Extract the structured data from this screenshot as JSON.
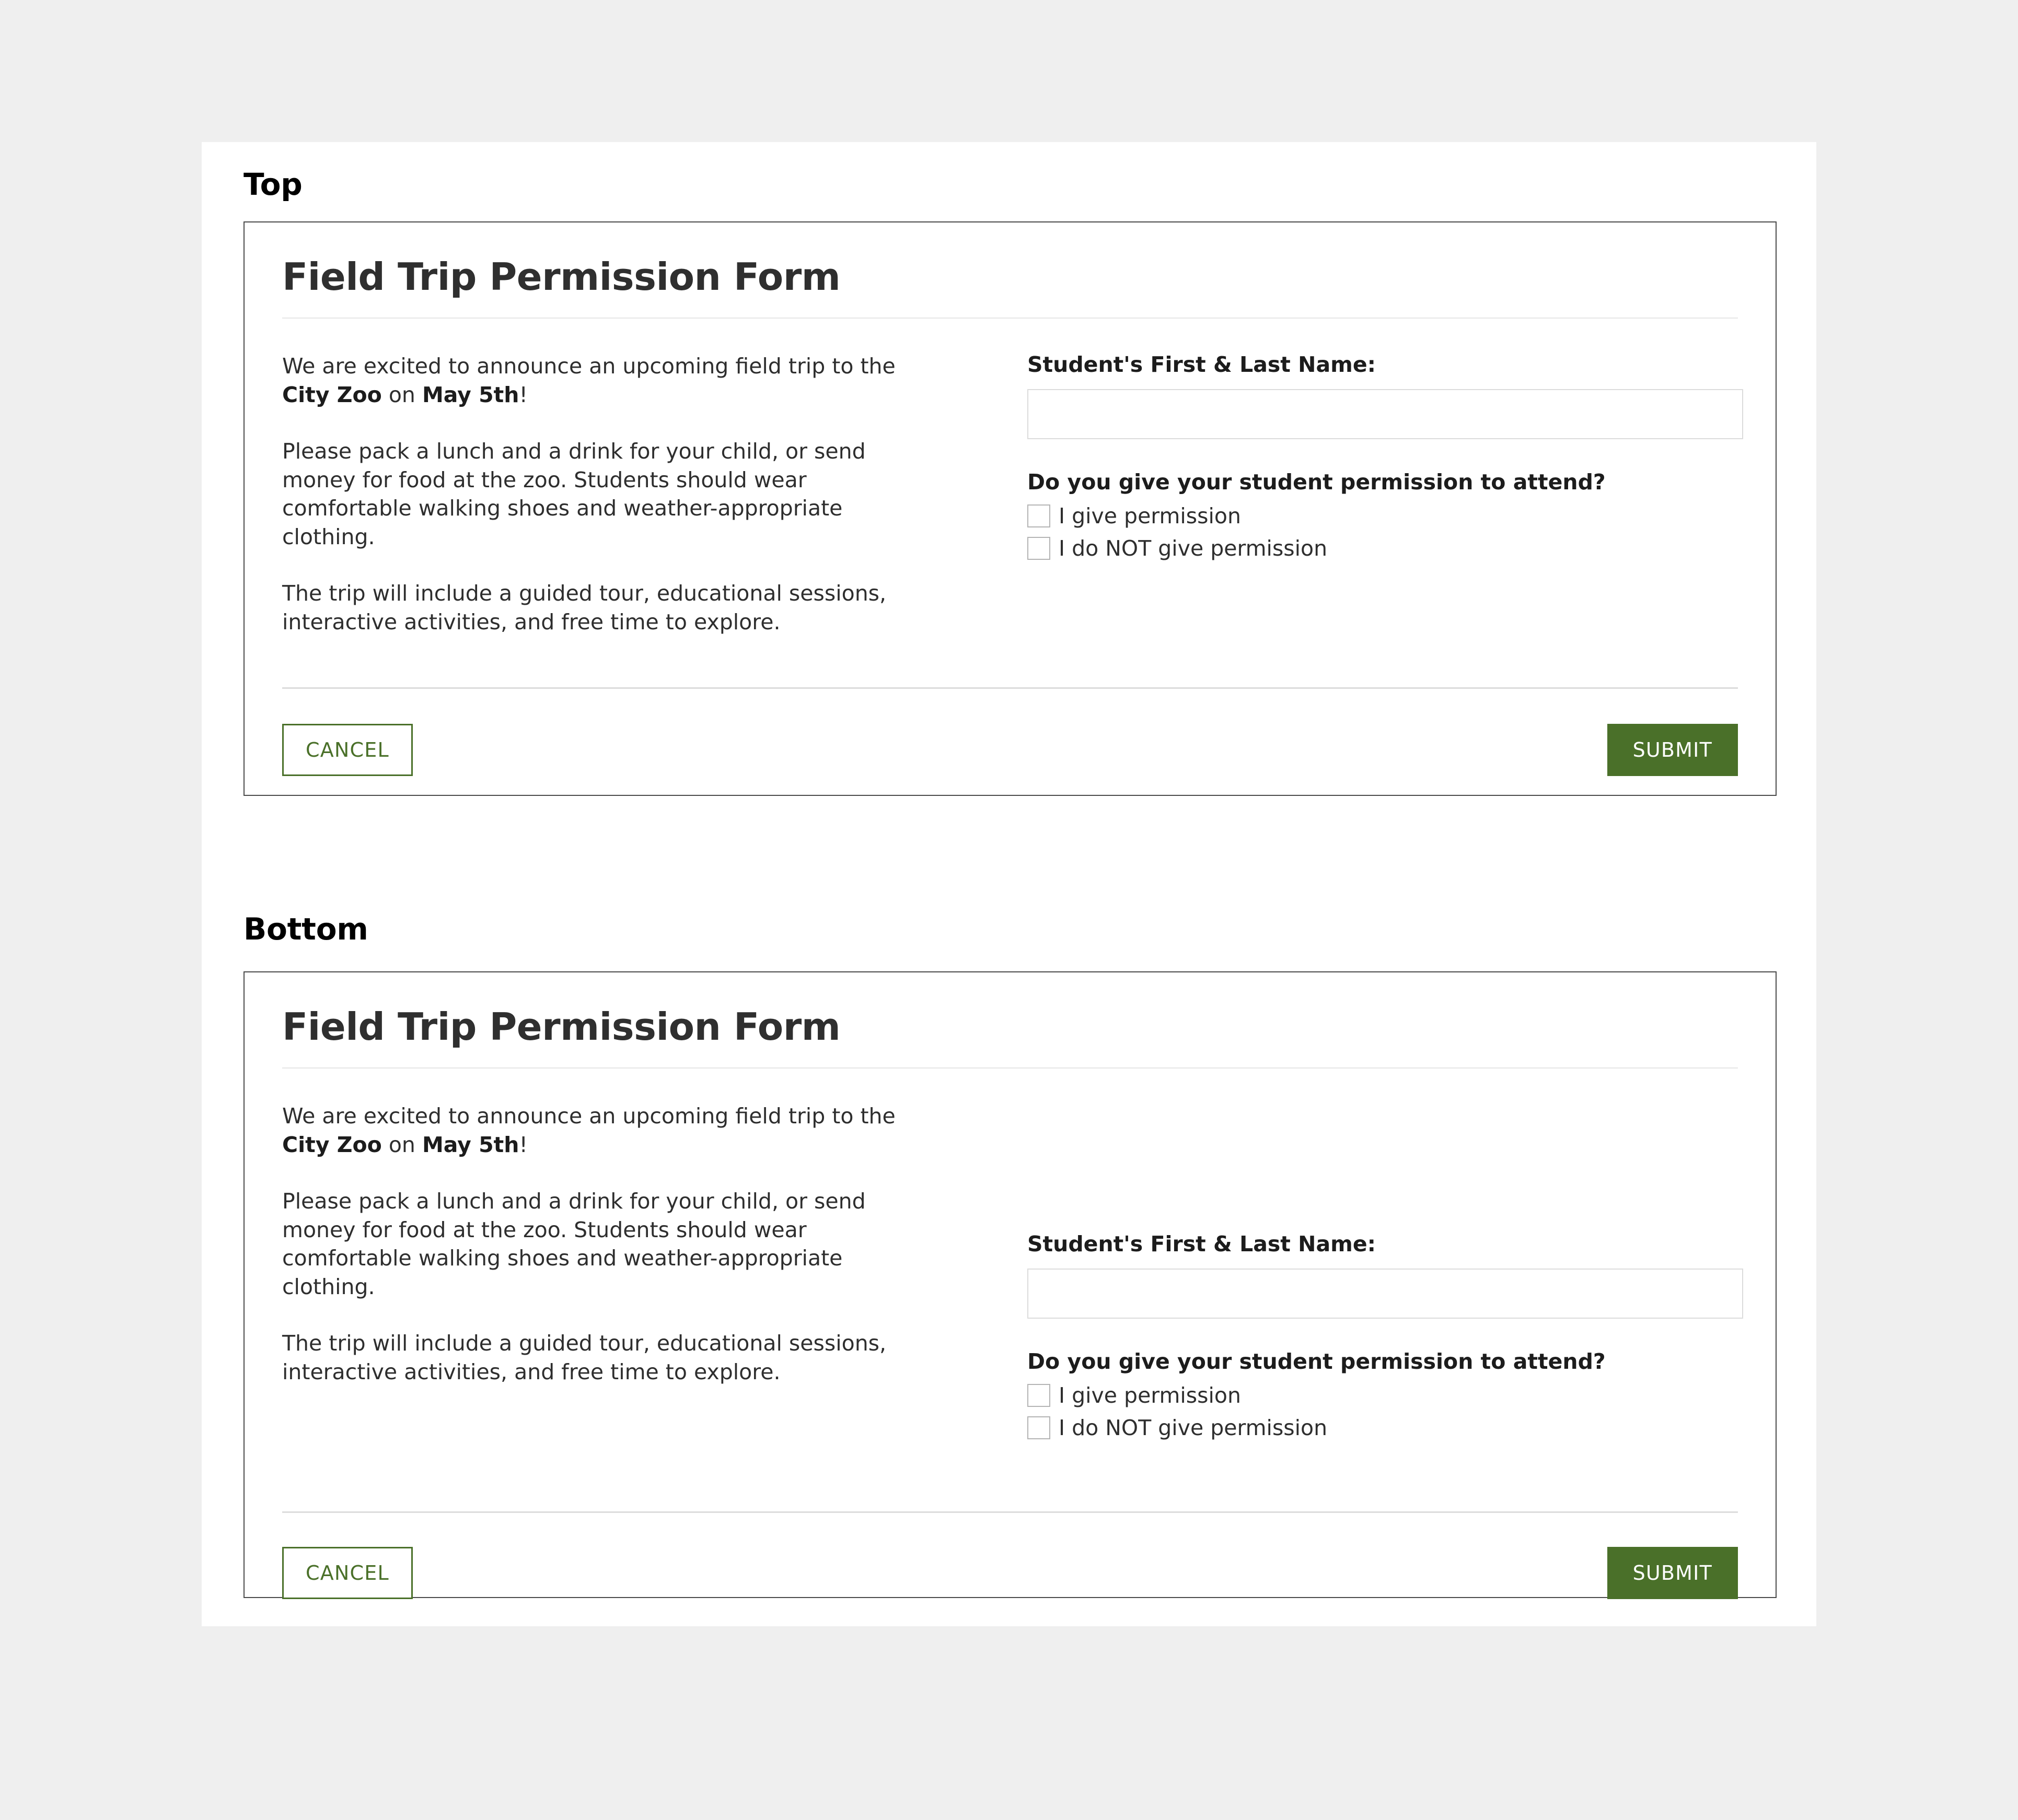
{
  "page": {
    "background_color": "#efefef",
    "panel_background": "#ffffff"
  },
  "theme": {
    "accent_green": "#4a7029",
    "heading_color": "#2f2f2f",
    "body_text_color": "#2e2e2e",
    "border_color": "#4a4a4a",
    "rule_color": "#e6e6e6",
    "input_border_color": "#dcdcdc",
    "checkbox_border_color": "#b4b4b4"
  },
  "sections": {
    "top": {
      "label": "Top"
    },
    "bottom": {
      "label": "Bottom"
    }
  },
  "form": {
    "title": "Field Trip Permission Form",
    "paragraphs": {
      "intro_prefix": "We are excited to announce an upcoming field trip to the ",
      "intro_place": "City Zoo",
      "intro_middle": " on ",
      "intro_date": "May 5th",
      "intro_suffix": "!",
      "packing": "Please pack a lunch and a drink for your child, or send money for food at the zoo. Students should wear comfortable walking shoes and weather-appropriate clothing.",
      "itinerary": "The trip will include a guided tour, educational sessions, interactive activities, and free time to explore."
    },
    "name_field": {
      "label": "Student's First & Last Name:",
      "value": "",
      "placeholder": ""
    },
    "permission_question": "Do you give your student permission to attend?",
    "permission_options": [
      {
        "label": "I give permission",
        "checked": false
      },
      {
        "label": "I do NOT give permission",
        "checked": false
      }
    ],
    "buttons": {
      "cancel": "CANCEL",
      "submit": "SUBMIT"
    }
  }
}
